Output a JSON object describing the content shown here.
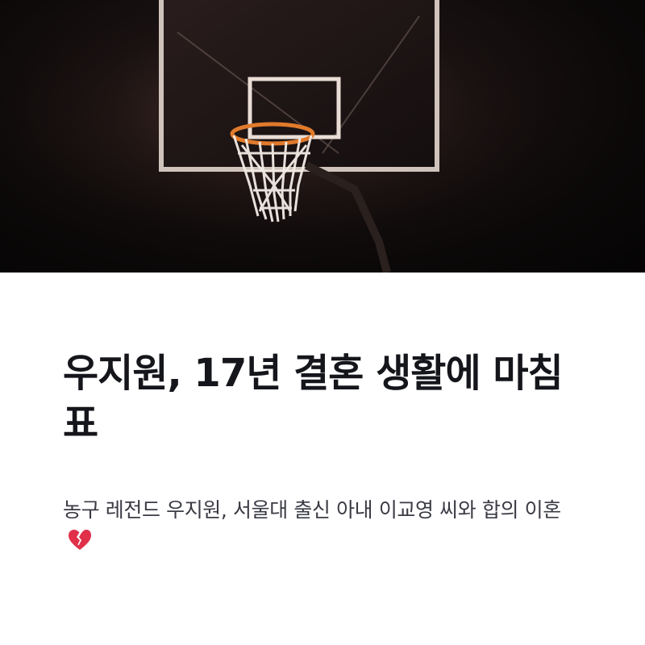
{
  "hero": {
    "alt_icon": "basketball-hoop-image"
  },
  "article": {
    "title": "우지원, 17년 결혼 생활에 마침표",
    "subtitle": "농구 레전드 우지원, 서울대 출신 아내 이교영 씨와 합의 이혼",
    "emoji_icon": "broken-heart-icon"
  },
  "colors": {
    "title": "#15161b",
    "subtitle": "#3a3b44",
    "heart": "#e0304a"
  }
}
